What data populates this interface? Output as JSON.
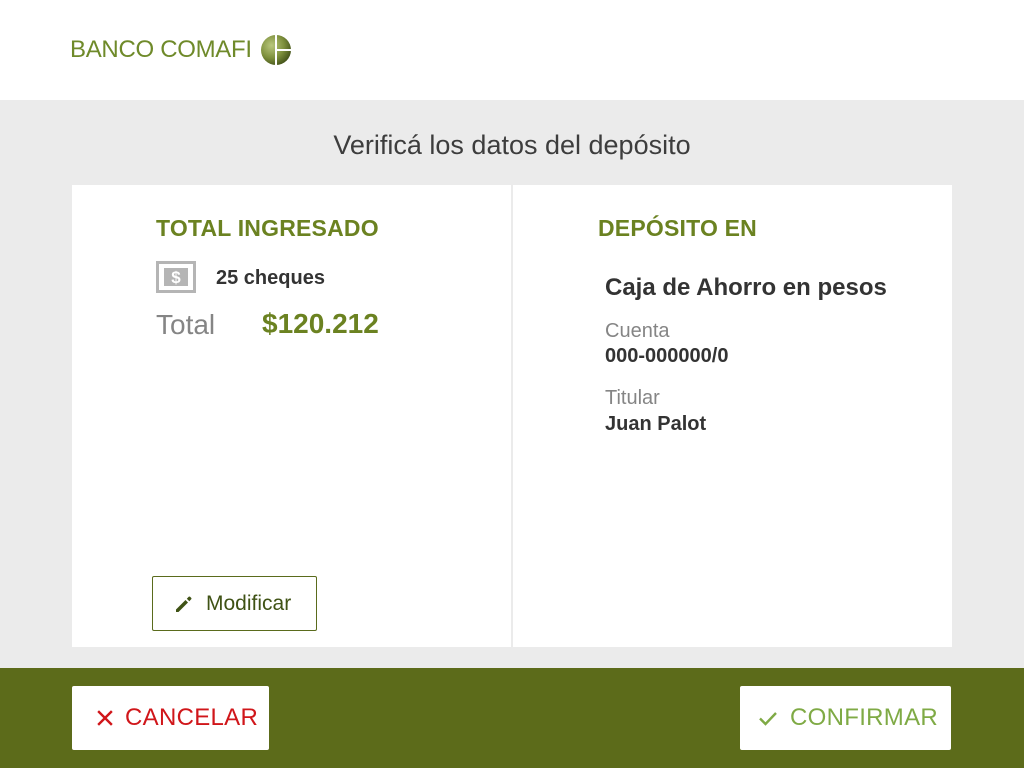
{
  "header": {
    "logo_text": "BANCO COMAFI",
    "logo_icon": "comafi-globe-icon"
  },
  "main": {
    "title": "Verificá los datos del depósito"
  },
  "left_panel": {
    "heading": "TOTAL INGRESADO",
    "cheque_icon": "cheque-dollar-icon",
    "cheque_count": "25 cheques",
    "total_label": "Total",
    "total_value": "$120.212",
    "modify_button": {
      "icon": "pencil-icon",
      "label": "Modificar"
    }
  },
  "right_panel": {
    "heading": "DEPÓSITO EN",
    "account_type": "Caja de Ahorro en pesos",
    "account_label": "Cuenta",
    "account_number": "000-000000/0",
    "holder_label": "Titular",
    "holder_name": "Juan Palot"
  },
  "footer": {
    "cancel_button": {
      "icon": "close-icon",
      "label": "CANCELAR"
    },
    "confirm_button": {
      "icon": "check-icon",
      "label": "CONFIRMAR"
    }
  },
  "colors": {
    "brand_green": "#6b8221",
    "footer_green": "#5c6b1a",
    "cancel_red": "#d0161a",
    "confirm_green": "#7faa45",
    "background_grey": "#ebebeb"
  }
}
